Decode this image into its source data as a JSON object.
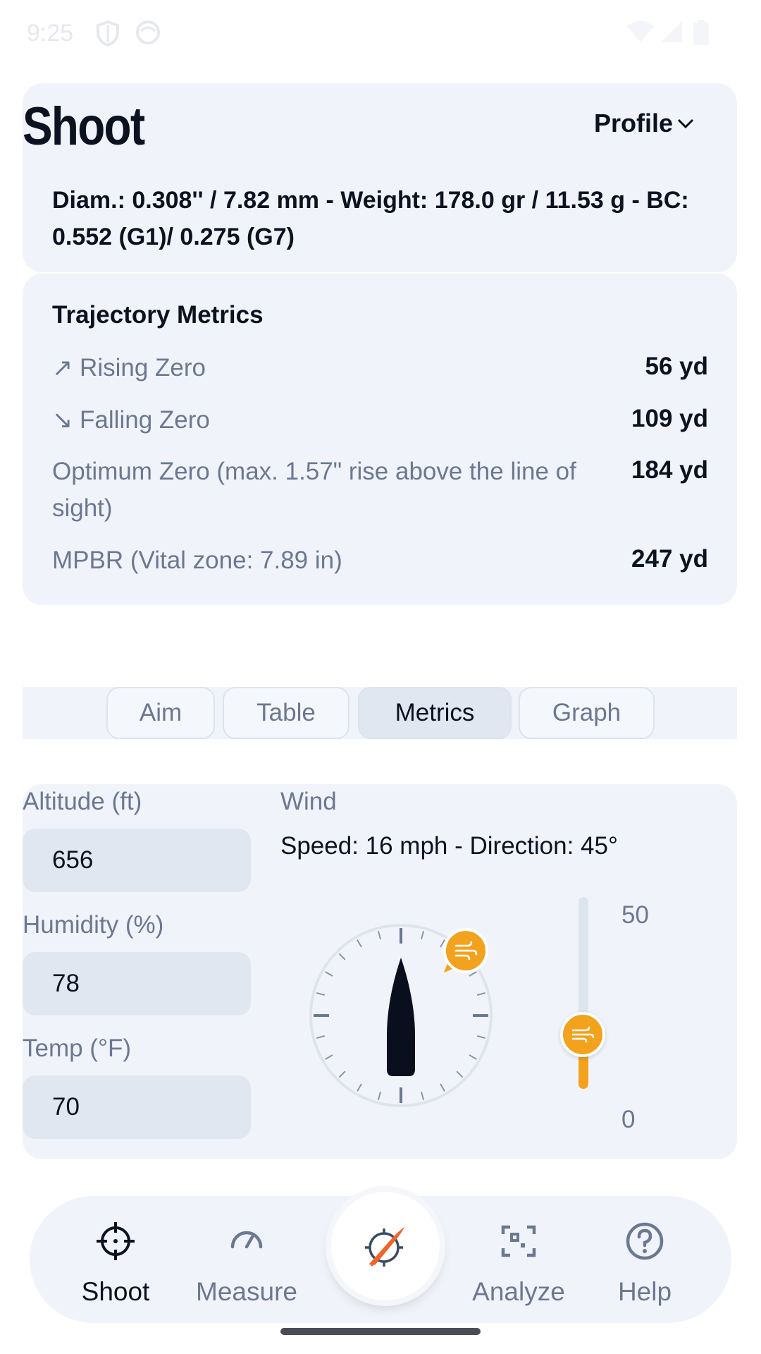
{
  "status": {
    "time": "9:25"
  },
  "header": {
    "title": "Shoot",
    "profile_label": "Profile",
    "bullet_info": "Diam.: 0.308'' / 7.82 mm - Weight: 178.0 gr / 11.53 g - BC: 0.552 (G1)/ 0.275 (G7)"
  },
  "metrics": {
    "title": "Trajectory Metrics",
    "rows": [
      {
        "label": "↗ Rising Zero",
        "value": "56 yd"
      },
      {
        "label": "↘ Falling Zero",
        "value": "109 yd"
      },
      {
        "label": "Optimum Zero (max. 1.57\" rise above the line of sight)",
        "value": "184 yd"
      },
      {
        "label": "MPBR (Vital zone: 7.89 in)",
        "value": "247 yd"
      }
    ]
  },
  "tabs": [
    {
      "label": "Aim",
      "active": false
    },
    {
      "label": "Table",
      "active": false
    },
    {
      "label": "Metrics",
      "active": true
    },
    {
      "label": "Graph",
      "active": false
    }
  ],
  "conditions": {
    "altitude_label": "Altitude (ft)",
    "altitude_value": "656",
    "humidity_label": "Humidity (%)",
    "humidity_value": "78",
    "temp_label": "Temp (°F)",
    "temp_value": "70"
  },
  "wind": {
    "label": "Wind",
    "summary": "Speed: 16 mph - Direction: 45°",
    "speed_mph": 16,
    "direction_deg": 45,
    "slider_max": "50",
    "slider_min": "0",
    "slider_level": 0.32
  },
  "nav": {
    "items": [
      {
        "label": "Shoot",
        "icon": "crosshair-icon",
        "active": true
      },
      {
        "label": "Measure",
        "icon": "gauge-icon",
        "active": false
      },
      {
        "label": "Analyze",
        "icon": "scan-icon",
        "active": false
      },
      {
        "label": "Help",
        "icon": "help-icon",
        "active": false
      }
    ],
    "fab_icon": "bullet-target-icon"
  },
  "colors": {
    "accent": "#f2a21c",
    "card": "#f0f4fa",
    "muted_text": "#6b7890",
    "fab_bullet": "#f0642a"
  }
}
